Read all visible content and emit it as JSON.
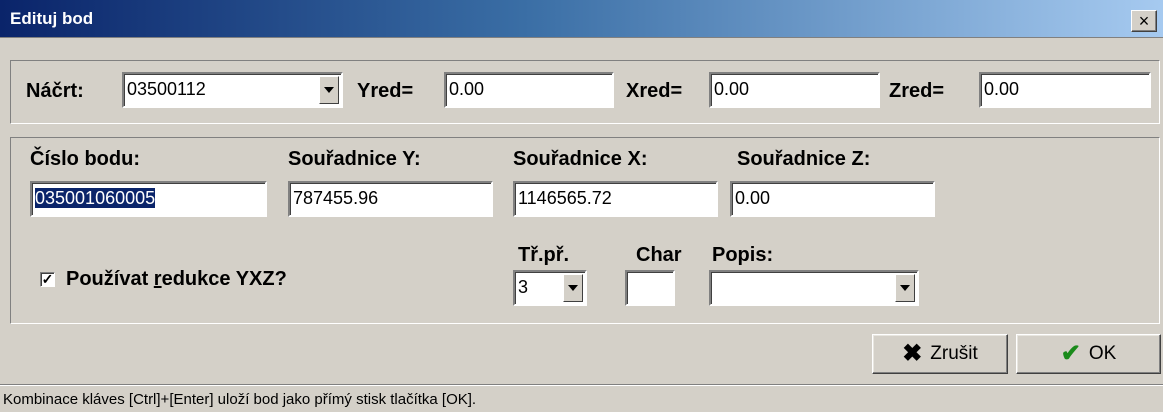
{
  "window": {
    "title": "Edituj bod",
    "close_label": "×"
  },
  "reductions": {
    "sketch_label": "Náčrt:",
    "sketch_value": "03500112",
    "yred_label": "Yred=",
    "yred_value": "0.00",
    "xred_label": "Xred=",
    "xred_value": "0.00",
    "zred_label": "Zred=",
    "zred_value": "0.00"
  },
  "point": {
    "number_label": "Číslo bodu:",
    "number_value": "035001060005",
    "y_label": "Souřadnice Y:",
    "y_value": "787455.96",
    "x_label": "Souřadnice X:",
    "x_value": "1146565.72",
    "z_label": "Souřadnice Z:",
    "z_value": "0.00",
    "use_reductions_label": "Používat redukce YXZ?",
    "use_reductions_checked": true,
    "class_label": "Tř.př.",
    "class_value": "3",
    "char_label": "Char",
    "char_value": "",
    "description_label": "Popis:",
    "description_value": ""
  },
  "buttons": {
    "cancel_label": "Zrušit",
    "ok_label": "OK",
    "cancel_icon": "x-icon",
    "ok_icon": "checkmark-icon"
  },
  "status": {
    "text": "Kombinace kláves [Ctrl]+[Enter] uloží bod jako přímý stisk tlačítka [OK]."
  },
  "colors": {
    "titlebar_start": "#0a246a",
    "titlebar_end": "#a6caf0",
    "dialog_bg": "#d4d0c8",
    "selection": "#0a246a",
    "ok_check": "#1a8a1a"
  }
}
